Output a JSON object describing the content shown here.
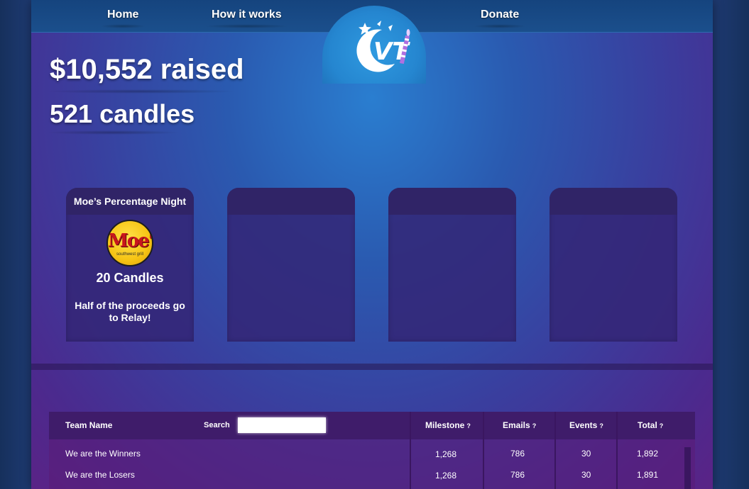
{
  "nav": {
    "home": "Home",
    "how_it_works": "How it works",
    "donate": "Donate"
  },
  "logo": {
    "text": "VT"
  },
  "stats": {
    "raised": "$10,552 raised",
    "candles": "521 candles"
  },
  "cards": [
    {
      "title": "Moe’s Percentage Night",
      "logo_text": "Moe's",
      "logo_sub": "southwest grill",
      "candles": "20 Candles",
      "description": "Half of the proceeds go to Relay!"
    },
    {
      "title": ""
    },
    {
      "title": ""
    },
    {
      "title": ""
    }
  ],
  "table": {
    "headers": {
      "team_name": "Team Name",
      "search_label": "Search",
      "milestone": "Milestone",
      "emails": "Emails",
      "events": "Events",
      "total": "Total",
      "help": "?"
    },
    "search_value": "",
    "rows": [
      {
        "team": "We are the Winners",
        "milestone": "1,268",
        "emails": "786",
        "events": "30",
        "total": "1,892"
      },
      {
        "team": "We are the Losers",
        "milestone": "1,268",
        "emails": "786",
        "events": "30",
        "total": "1,891"
      }
    ]
  },
  "colors": {
    "accent_purple": "#b070e0",
    "nav_blue": "#1b4f8c",
    "logo_dome": "#2586d0"
  }
}
